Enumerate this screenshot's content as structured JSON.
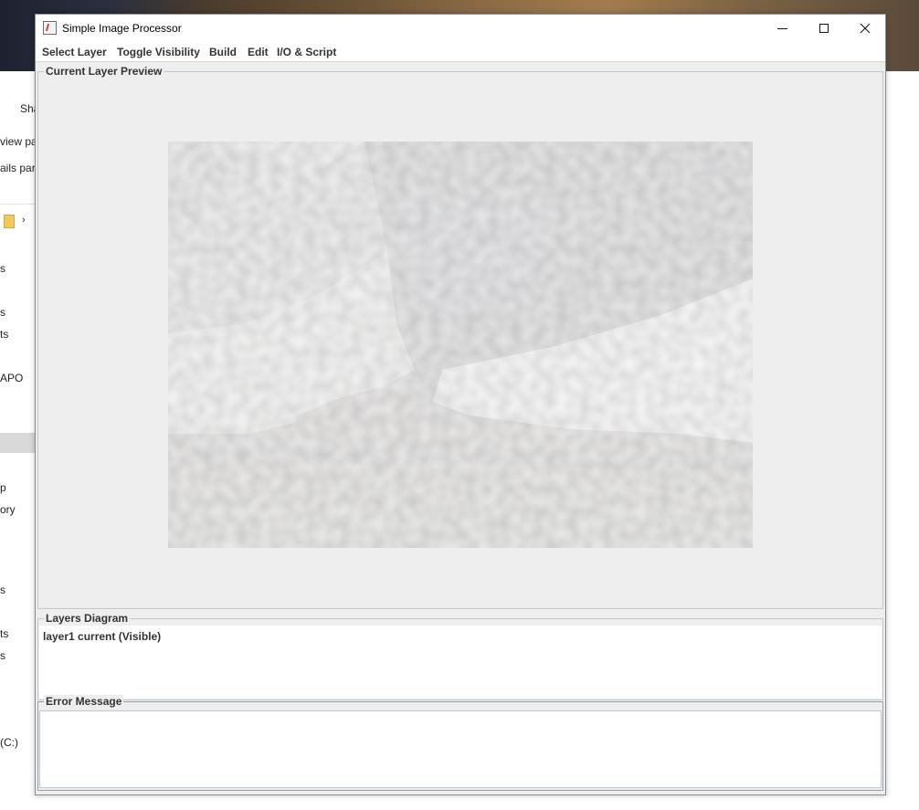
{
  "window": {
    "title": "Simple Image Processor"
  },
  "menu": {
    "items": [
      "Select Layer",
      "Toggle Visibility",
      "Build",
      "Edit",
      "I/O & Script"
    ]
  },
  "preview": {
    "panel_title": "Current Layer Preview"
  },
  "layers": {
    "panel_title": "Layers Diagram",
    "entries": [
      "layer1 current (Visible)"
    ]
  },
  "error": {
    "panel_title": "Error Message",
    "message": ""
  },
  "background": {
    "fragments": [
      "Sha",
      "view pa",
      "ails par",
      "s",
      "s",
      "ts",
      "APO",
      "p",
      "ory",
      "s",
      "ts",
      "s",
      "(C:)"
    ]
  },
  "icons": {
    "app": "image-processor-icon",
    "minimize": "minimize-icon",
    "maximize": "maximize-icon",
    "close": "close-icon",
    "folder": "folder-icon",
    "chevron": "chevron-right-icon"
  },
  "colors": {
    "window_bg": "#eeeeee",
    "panel_border": "#b9c7d6",
    "menu_text": "#333333"
  }
}
